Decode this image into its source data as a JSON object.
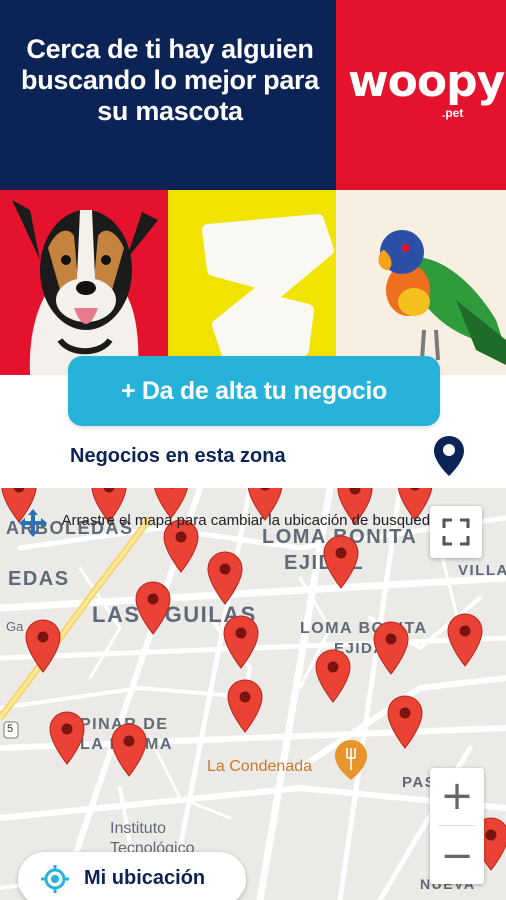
{
  "banner": {
    "headline": "Cerca de ti hay alguien buscando lo mejor para su mascota",
    "logo_text": "woopy",
    "logo_sub": ".pet"
  },
  "cta": {
    "label": "+ Da de alta tu negocio"
  },
  "section": {
    "title": "Negocios en esta zona",
    "icon": "location-pin-icon"
  },
  "map": {
    "drag_hint": "Arrastre el mapa para cambiar la ubicación de busqueda",
    "labels": {
      "arboledas": "ARBOLEDAS",
      "loma_bonita_top": "LOMA BONITA",
      "ejidal_top": "EJIDAL",
      "edas": "EDAS",
      "villa": "VILLA",
      "las_aguilas": "LAS AGUILAS",
      "ga": "Ga",
      "loma_bonita_mid": "LOMA BONITA",
      "ejidal_mid": "EJIDAL",
      "pinar_1": "PINAR DE",
      "pinar_2": "LA PALMA",
      "la_condenada": "La Condenada",
      "paseos": "PASEOS",
      "instituto_1": "Instituto",
      "instituto_2": "Tecnológico",
      "nueva": "NUEVA",
      "route": "5"
    },
    "business_marker_count": 20,
    "zoom_in": "+",
    "zoom_out": "−",
    "my_location_label": "Mi ubicación"
  },
  "colors": {
    "navy": "#0c2355",
    "brand_red": "#e5122d",
    "yellow": "#f0e300",
    "cream": "#f6efe2",
    "cta_blue": "#27b3d9",
    "marker_red": "#ea4335"
  }
}
